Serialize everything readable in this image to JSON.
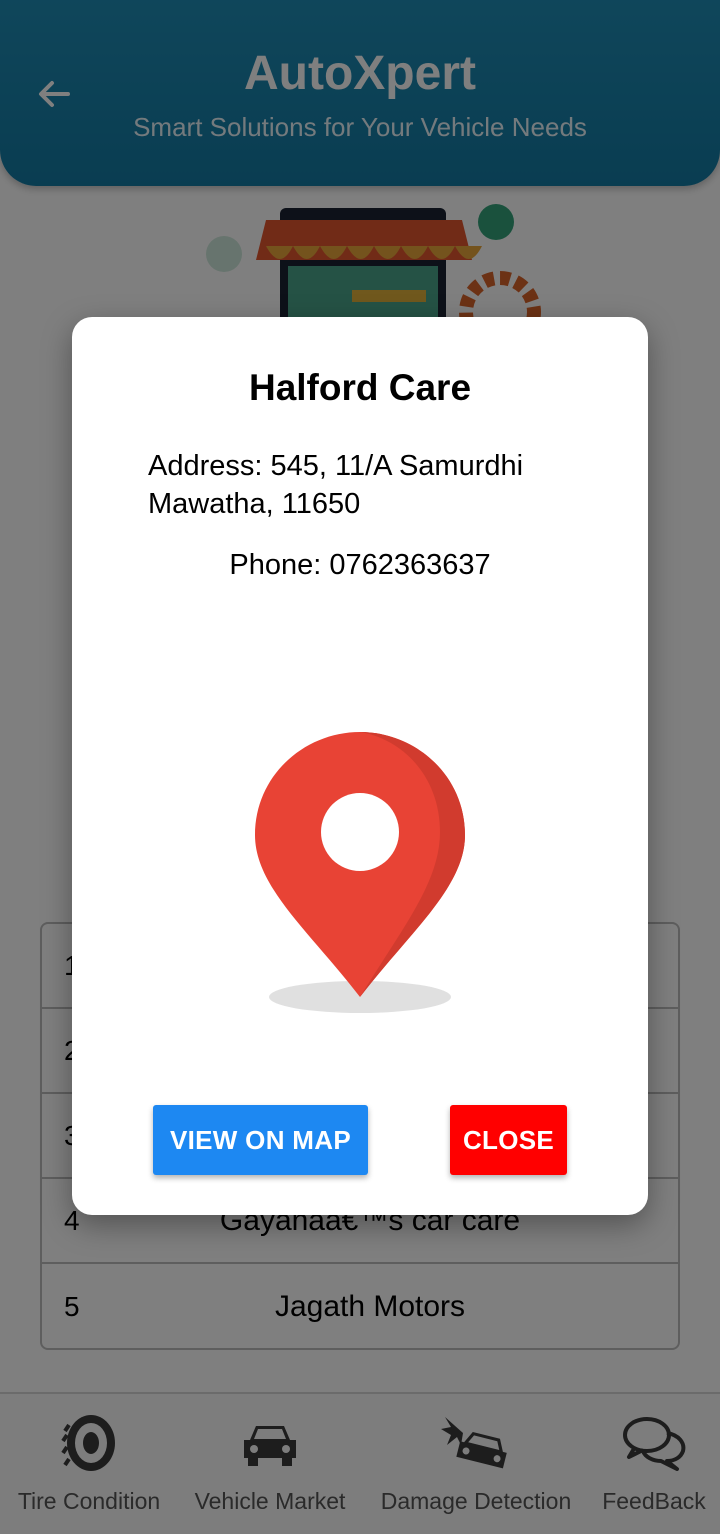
{
  "header": {
    "title": "AutoXpert",
    "subtitle": "Smart Solutions for Your Vehicle Needs",
    "back_icon": "arrow-left-icon"
  },
  "shops": [
    {
      "num": "1",
      "name": ""
    },
    {
      "num": "2",
      "name": ""
    },
    {
      "num": "3",
      "name": ""
    },
    {
      "num": "4",
      "name": "Gayanaâ€™s car care"
    },
    {
      "num": "5",
      "name": "Jagath Motors"
    }
  ],
  "bottom_nav": [
    {
      "label": "Tire Condition",
      "icon": "tire-icon"
    },
    {
      "label": "Vehicle Market",
      "icon": "car-icon"
    },
    {
      "label": "Damage Detection",
      "icon": "car-crash-icon"
    },
    {
      "label": "FeedBack",
      "icon": "chat-bubbles-icon"
    }
  ],
  "dialog": {
    "title": "Halford Care",
    "address": "Address: 545, 11/A Samurdhi Mawatha, 11650",
    "phone": "Phone: 0762363637",
    "map_button": "VIEW ON MAP",
    "close_button": "CLOSE",
    "pin_icon": "location-pin-icon"
  },
  "colors": {
    "header": "#137aa3",
    "map_button": "#1d88f2",
    "close_button": "#ff0000",
    "pin": "#e84335"
  }
}
